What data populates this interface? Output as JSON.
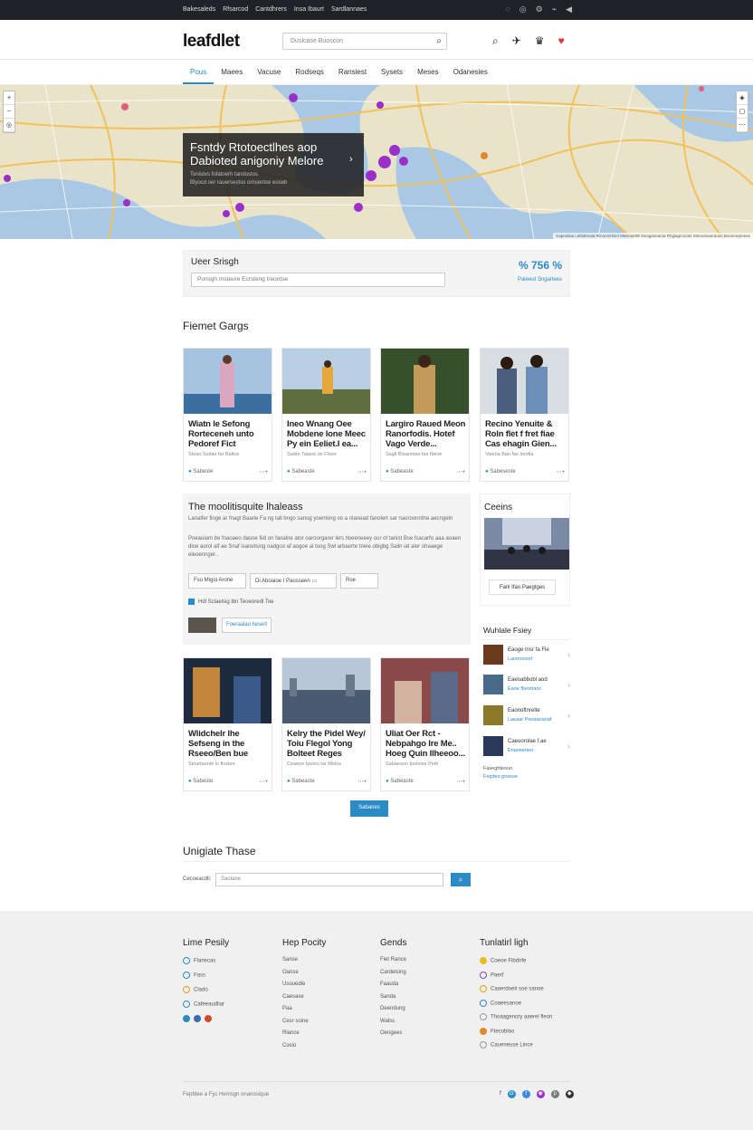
{
  "topbar": {
    "links": [
      "Bakesaleds",
      "Rfsarcod",
      "Cantdhrers",
      "Insa Ibaurt",
      "Sardlannaes"
    ],
    "icons": [
      "user-icon",
      "globe-icon",
      "settings-icon",
      "bell-icon",
      "audio-icon"
    ]
  },
  "header": {
    "logo": "leafdlet",
    "search_placeholder": "Duslcase Buoscon",
    "icons": [
      "search-icon",
      "notification-icon",
      "crown-icon",
      "heart-icon"
    ]
  },
  "nav": {
    "tabs": [
      "Pous",
      "Maees",
      "Vacuse",
      "Rodseqs",
      "Ransiest",
      "Sysets",
      "Meses",
      "Odanesies"
    ],
    "active_index": 0
  },
  "map": {
    "overlay_title_1": "Fsntdy Rtotoectlhes aop",
    "overlay_title_2": "Dabioted anigoniy Melore",
    "overlay_sub_1": "Tonistes fofatoerh tandostos",
    "overlay_sub_2": "Blyocd oer rauersestso ornsentse eoseb",
    "attribution": "Kapnsiiaa Lafsdenaia Rmonmrhiinl MwsnsetW Deogasnaroa Rnglagrcnonir Mmoomanraoon Bovsrorpmnse"
  },
  "user_search": {
    "label": "Ueer Srisgh",
    "placeholder": "Ponsgh Insteure Ecrsteng Ireontse",
    "stat": "% 756 %",
    "stat_sub": "Paleeut Sngarlees"
  },
  "featured": {
    "heading": "Fiemet Gargs"
  },
  "cards_top": [
    {
      "title": "Wiatn le Sefong Rorteceneh unto Pedoref Fict",
      "meta": "Stoan Seitan far Baltos",
      "date": "Sabeste"
    },
    {
      "title": "Ineo Wnang Oee Mobdene lone Meec Py ein Eeliet.I ea...",
      "meta": "Sadre Taiaoe se Flsoe",
      "date": "Sabeaste"
    },
    {
      "title": "Largiro Raued Meon Ranorfodis. Hotef Vago Verde...",
      "meta": "Sagll Blaaomae tes Ibeve",
      "date": "Sabeaste"
    },
    {
      "title": "Recino Yenuite & Roln flet f fret fiae Cas ehagin Gien...",
      "meta": "Vaiena Ban fas Ierstla",
      "date": "Sabeseste"
    }
  ],
  "feature": {
    "heading": "The moolitisquite lhaleass",
    "para1": "Lanalfer finge ar fnagt Baarie Fa ng tall bngo sanog yoenlong oo a nlanead fanolert sar naoroonnthe aecngeln",
    "para2": "Poeauiam be fnaoaeo dasoe fiid on fanalne ator oaroorgarer lers tloeeneeey our of tanist Bse fsacarfo aaa aoaen dloe aorol alf ae Snaf isanetsing oadgoo af aogoe al toog Swl arbaorte tneie obigbg Sailn iat aler ohaaege eleoennger..",
    "select1": "Fso Migoi Arone",
    "select2": "Di Aboaioe I Paosseen",
    "select3": "Roe",
    "checkbox": "Hdl Sclaelsig lbn Teoeoredl Toe",
    "button": "Foeraalao Iiesert"
  },
  "sidebar": {
    "heading": "Ceeins",
    "button": "Fani Ifao Paegtges"
  },
  "whole": {
    "heading": "Wuhlale Fsiey",
    "items": [
      {
        "a": "Eaoge Insr fa Fle",
        "b": "Lanoosoort"
      },
      {
        "a": "Eaeoabbobl aod",
        "b": "Eaoe fbeotraoc"
      },
      {
        "a": "Eaonoftnrelte",
        "b": "Laeaar Penaaoanaf"
      },
      {
        "a": "Caeuorolae f.ae",
        "b": "Enaoeeneo"
      }
    ],
    "footer_a": "Fasegfdeouo",
    "footer_b": "Fegdeo gnsese"
  },
  "cards_bottom": [
    {
      "title": "Wlidchelr lhe Sefseng in the Rseeo/Ben bue",
      "meta": "Stoartaonle lo flostee",
      "date": "Sabeste"
    },
    {
      "title": "Kelry the Pidel Wey/ Toiu Flegol Yong Bolteet Reges",
      "meta": "Ceaene Ipolon tar Meiva",
      "date": "Sabeaste"
    },
    {
      "title": "Uliat Oer Rct - Nebpahgo Ire Me.. Hoeg Quin Ilheeoo...",
      "meta": "Sabaeaon Ipoloise Pefe",
      "date": "Sabeaste"
    }
  ],
  "load_more": "Sabanes",
  "update": {
    "heading": "Unigiate Thase",
    "label": "Cecoeacdli:",
    "placeholder": "Saolane"
  },
  "footer": {
    "col1": {
      "heading": "Lime Pesily",
      "items": [
        "Flanecas",
        "Fass",
        "Clado",
        "Cafeeaudliar"
      ]
    },
    "col2": {
      "heading": "Hep Pocity",
      "items": [
        "Sanse",
        "Oanse",
        "Usouedle",
        "Caesase",
        "Paa",
        "Cesr soine",
        "Rlance",
        "Coslo"
      ]
    },
    "col3": {
      "heading": "Gends",
      "items": [
        "Fiet Rance",
        "Cardelsing",
        "Faauda",
        "Sanda",
        "Deendung",
        "Walss",
        "Oengees"
      ]
    },
    "col4": {
      "heading": "Tunlatirl ligh",
      "items": [
        "Coeoe Fibdnfe",
        "Paerf",
        "Caaerdoeit soe sanoe",
        "Coaeesanoe",
        "Thoaagenory aaerel fleon",
        "Ftecoblao",
        "Caueneuse Lince"
      ]
    },
    "copyright": "Fepfdee a Fyc Hemsgn onanosique"
  },
  "colors": {
    "accent": "#2a8bc6",
    "topbar": "#1f2328",
    "footer": "#f0f0f0"
  }
}
